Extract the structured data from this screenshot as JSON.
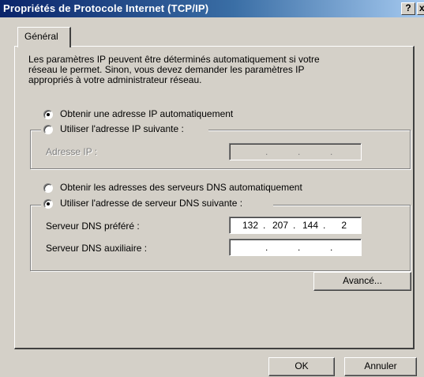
{
  "window": {
    "title": "Propriétés de Protocole Internet (TCP/IP)",
    "help_label": "?",
    "close_label": "x"
  },
  "tabs": [
    {
      "label": "Général"
    }
  ],
  "intro": {
    "lines": [
      "Les paramètres IP peuvent être déterminés automatiquement si votre",
      "réseau le permet. Sinon, vous devez demander les paramètres IP",
      "appropriés à votre administrateur réseau."
    ]
  },
  "ip": {
    "auto_label": "Obtenir une adresse IP automatiquement",
    "manual_label": "Utiliser l'adresse IP suivante :",
    "auto_selected": true,
    "address_label": "Adresse IP :",
    "address_octets": [
      "",
      "",
      "",
      ""
    ]
  },
  "dns": {
    "auto_label": "Obtenir les adresses des serveurs DNS automatiquement",
    "manual_label": "Utiliser l'adresse de serveur DNS suivante :",
    "manual_selected": true,
    "preferred_label": "Serveur DNS préféré :",
    "preferred_octets": [
      "132",
      "207",
      "144",
      "2"
    ],
    "alternate_label": "Serveur DNS auxiliaire :",
    "alternate_octets": [
      "",
      "",
      "",
      ""
    ]
  },
  "buttons": {
    "advanced": "Avancé...",
    "ok": "OK",
    "cancel": "Annuler"
  }
}
